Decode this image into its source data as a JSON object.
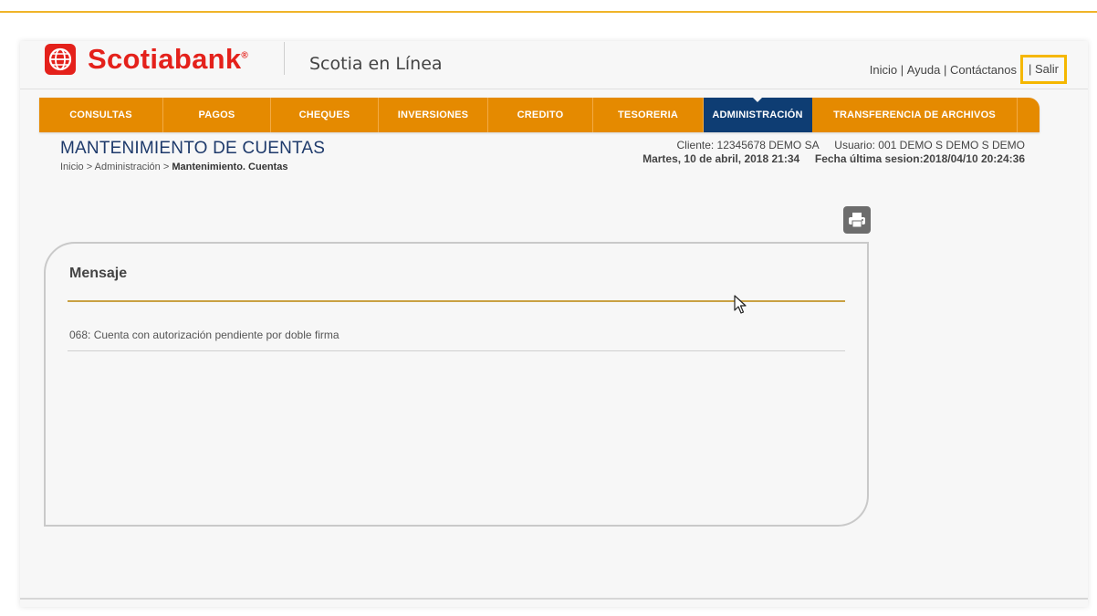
{
  "header": {
    "brand": "Scotiabank",
    "brand_mark": "®",
    "app_name": "Scotia en Línea",
    "links": {
      "inicio": "Inicio",
      "ayuda": "Ayuda",
      "contactanos": "Contáctanos",
      "salir": "Salir",
      "separator": " | "
    }
  },
  "nav": {
    "items": [
      {
        "label": "CONSULTAS"
      },
      {
        "label": "PAGOS"
      },
      {
        "label": "CHEQUES"
      },
      {
        "label": "INVERSIONES"
      },
      {
        "label": "CREDITO"
      },
      {
        "label": "TESORERIA"
      },
      {
        "label": "ADMINISTRACIÓN"
      },
      {
        "label": "TRANSFERENCIA DE ARCHIVOS"
      }
    ],
    "active_index": 6
  },
  "page": {
    "title": "MANTENIMIENTO DE CUENTAS",
    "breadcrumb": {
      "home": "Inicio",
      "sep": " > ",
      "section": "Administración",
      "current": "Mantenimiento. Cuentas"
    }
  },
  "session": {
    "cliente": "Cliente: 12345678  DEMO SA",
    "usuario": "Usuario: 001 DEMO S DEMO S DEMO",
    "fecha": "Martes, 10 de abril, 2018 21:34",
    "ultima_sesion": "Fecha última sesion:2018/04/10 20:24:36"
  },
  "toolbar": {
    "print_icon": "printer-icon"
  },
  "message": {
    "title": "Mensaje",
    "text": "068: Cuenta con autorización pendiente por doble firma"
  },
  "colors": {
    "brand_red": "#e4211b",
    "nav_orange": "#e58a00",
    "nav_active": "#0e3d73",
    "highlight": "#f5b700",
    "panel_rule": "#c9a143"
  }
}
